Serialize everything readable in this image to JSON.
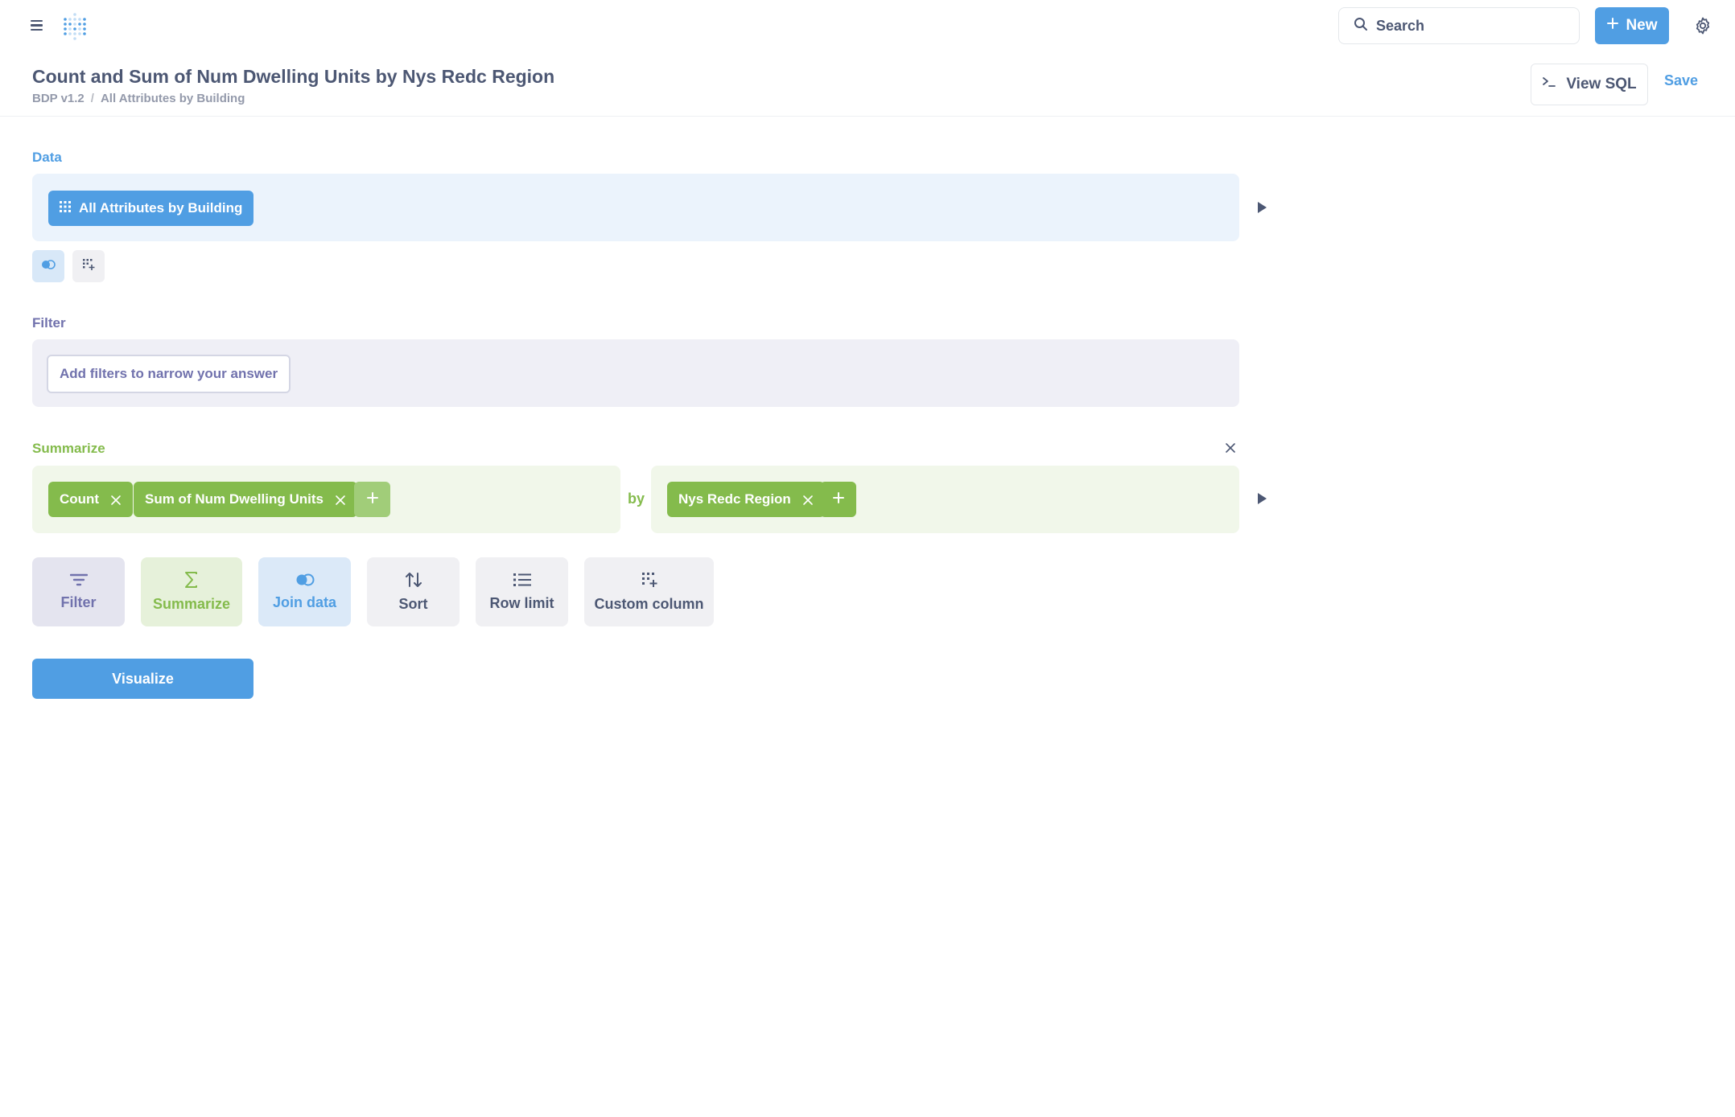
{
  "nav": {
    "search_placeholder": "Search",
    "new_label": "New"
  },
  "header": {
    "title": "Count and Sum of Num Dwelling Units by Nys Redc Region",
    "breadcrumbs": [
      "BDP v1.2",
      "All Attributes by Building"
    ],
    "breadcrumb_separator": "/",
    "view_sql_label": "View SQL",
    "save_label": "Save"
  },
  "data_section": {
    "label": "Data",
    "source": "All Attributes by Building"
  },
  "filter_section": {
    "label": "Filter",
    "placeholder": "Add filters to narrow your answer"
  },
  "summarize_section": {
    "label": "Summarize",
    "metrics": [
      "Count",
      "Sum of Num Dwelling Units"
    ],
    "by_label": "by",
    "breakouts": [
      "Nys Redc Region"
    ]
  },
  "steps": {
    "filter": "Filter",
    "summarize": "Summarize",
    "join": "Join data",
    "sort": "Sort",
    "row_limit": "Row limit",
    "custom_column": "Custom column"
  },
  "visualize_label": "Visualize",
  "colors": {
    "brand": "#509ee3",
    "filter": "#7172ad",
    "summarize": "#84bb4c",
    "text": "#4c5773"
  }
}
